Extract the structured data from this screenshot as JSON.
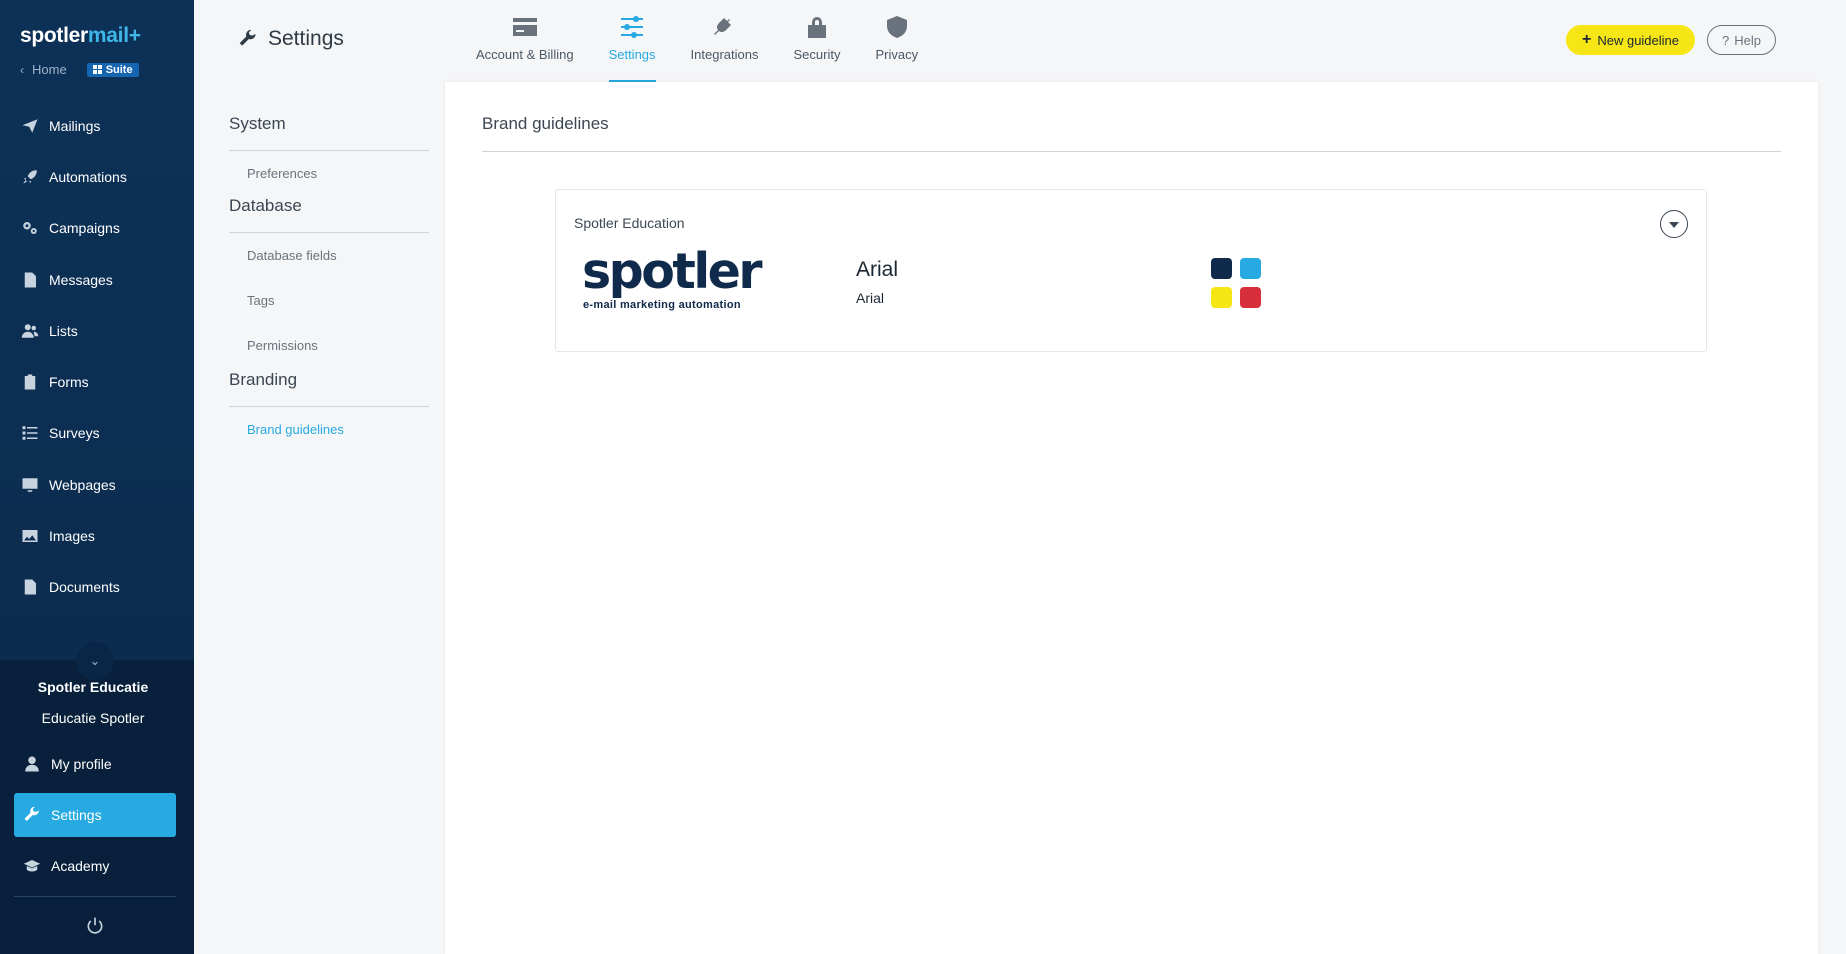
{
  "app": {
    "logo_main": "spotler",
    "logo_accent": "mail+",
    "home_label": "Home",
    "suite_label": "Suite"
  },
  "sidebar": {
    "items": [
      {
        "label": "Mailings",
        "icon": "paper-plane-icon"
      },
      {
        "label": "Automations",
        "icon": "rocket-icon"
      },
      {
        "label": "Campaigns",
        "icon": "gears-icon"
      },
      {
        "label": "Messages",
        "icon": "document-icon"
      },
      {
        "label": "Lists",
        "icon": "users-icon"
      },
      {
        "label": "Forms",
        "icon": "clipboard-icon"
      },
      {
        "label": "Surveys",
        "icon": "list-icon"
      },
      {
        "label": "Webpages",
        "icon": "monitor-icon"
      },
      {
        "label": "Images",
        "icon": "image-icon"
      },
      {
        "label": "Documents",
        "icon": "file-icon"
      }
    ],
    "account_name": "Spotler Educatie",
    "account_user": "Educatie Spotler",
    "my_profile": "My profile",
    "settings": "Settings",
    "academy": "Academy"
  },
  "header": {
    "title": "Settings",
    "tabs": [
      {
        "label": "Account & Billing",
        "icon": "credit-card-icon"
      },
      {
        "label": "Settings",
        "icon": "sliders-icon",
        "active": true
      },
      {
        "label": "Integrations",
        "icon": "plug-icon"
      },
      {
        "label": "Security",
        "icon": "lock-icon"
      },
      {
        "label": "Privacy",
        "icon": "shield-icon"
      }
    ],
    "new_guideline": "New guideline",
    "help": "Help"
  },
  "subnav": {
    "sections": [
      {
        "heading": "System",
        "links": [
          "Preferences"
        ]
      },
      {
        "heading": "Database",
        "links": [
          "Database fields",
          "Tags",
          "Permissions"
        ]
      },
      {
        "heading": "Branding",
        "links": [
          "Brand guidelines"
        ]
      }
    ],
    "active_link": "Brand guidelines"
  },
  "main": {
    "title": "Brand guidelines",
    "card": {
      "name": "Spotler Education",
      "logo_word": "spotler",
      "logo_tagline": "e-mail marketing automation",
      "primary_font": "Arial",
      "secondary_font": "Arial",
      "colors": [
        "#0f2a4a",
        "#27a9e1",
        "#f6e615",
        "#d62f3a"
      ]
    }
  },
  "colors": {
    "sidebar_bg": "#0d3157",
    "accent": "#27a9e1",
    "cta": "#f6e615"
  }
}
